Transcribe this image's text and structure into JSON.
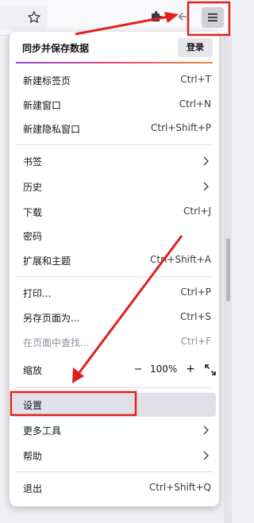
{
  "colors": {
    "annotation_red": "#e02020",
    "accent_gradient": [
      "#8b4bd9",
      "#e8457e",
      "#f58c3b"
    ],
    "highlight": "#e0e0e6"
  },
  "toolbar": {
    "icons": [
      "star-icon",
      "extension-icon",
      "back-arrow-icon",
      "hamburger-menu-icon"
    ]
  },
  "menu": {
    "sync_title": "同步并保存数据",
    "signin_label": "登录",
    "items": [
      {
        "label": "新建标签页",
        "shortcut": "Ctrl+T"
      },
      {
        "label": "新建窗口",
        "shortcut": "Ctrl+N"
      },
      {
        "label": "新建隐私窗口",
        "shortcut": "Ctrl+Shift+P"
      },
      {
        "label": "书签",
        "shortcut": ""
      },
      {
        "label": "历史",
        "shortcut": ""
      },
      {
        "label": "下载",
        "shortcut": "Ctrl+J"
      },
      {
        "label": "密码",
        "shortcut": ""
      },
      {
        "label": "扩展和主题",
        "shortcut": "Ctrl+Shift+A"
      },
      {
        "label": "打印...",
        "shortcut": "Ctrl+P"
      },
      {
        "label": "另存页面为...",
        "shortcut": "Ctrl+S"
      },
      {
        "label": "在页面中查找...",
        "shortcut": "Ctrl+F"
      },
      {
        "label": "缩放",
        "shortcut": ""
      },
      {
        "label": "设置",
        "shortcut": ""
      },
      {
        "label": "更多工具",
        "shortcut": ""
      },
      {
        "label": "帮助",
        "shortcut": ""
      },
      {
        "label": "退出",
        "shortcut": "Ctrl+Shift+Q"
      }
    ],
    "zoom": {
      "minus": "−",
      "level": "100%",
      "plus": "+"
    }
  }
}
